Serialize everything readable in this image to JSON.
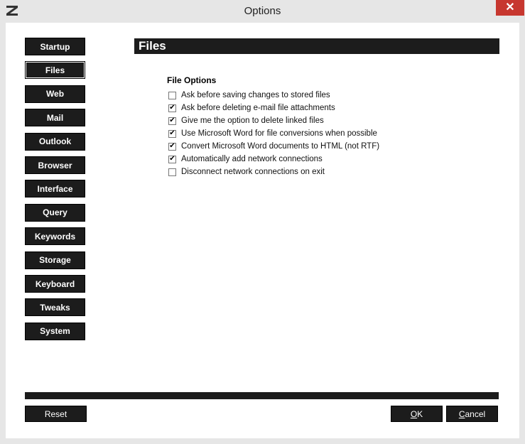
{
  "window": {
    "title": "Options",
    "close_glyph": "✕"
  },
  "sidebar": {
    "items": [
      {
        "label": "Startup"
      },
      {
        "label": "Files",
        "active": true
      },
      {
        "label": "Web"
      },
      {
        "label": "Mail"
      },
      {
        "label": "Outlook"
      },
      {
        "label": "Browser"
      },
      {
        "label": "Interface"
      },
      {
        "label": "Query"
      },
      {
        "label": "Keywords"
      },
      {
        "label": "Storage"
      },
      {
        "label": "Keyboard"
      },
      {
        "label": "Tweaks"
      },
      {
        "label": "System"
      }
    ]
  },
  "main": {
    "section_title": "Files",
    "group_title": "File Options",
    "options": [
      {
        "label": "Ask before saving changes to stored files",
        "checked": false
      },
      {
        "label": "Ask before deleting e-mail file attachments",
        "checked": true
      },
      {
        "label": "Give me the option to delete linked files",
        "checked": true
      },
      {
        "label": "Use Microsoft Word for file conversions when possible",
        "checked": true
      },
      {
        "label": "Convert Microsoft Word documents to HTML (not RTF)",
        "checked": true
      },
      {
        "label": "Automatically add network connections",
        "checked": true
      },
      {
        "label": "Disconnect network connections on exit",
        "checked": false
      }
    ]
  },
  "footer": {
    "reset_label": "Reset",
    "ok_label": "OK",
    "cancel_label": "Cancel"
  },
  "colors": {
    "button_bg": "#1c1c1c",
    "close_bg": "#c7372f"
  }
}
